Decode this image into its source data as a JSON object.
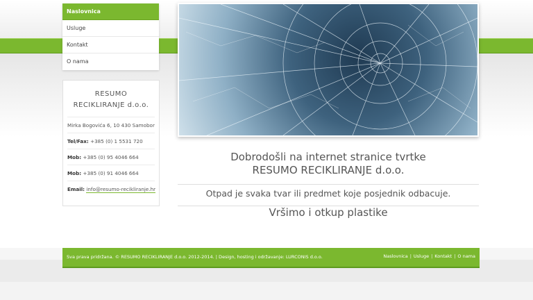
{
  "nav": {
    "items": [
      {
        "label": "Naslovnica",
        "active": true
      },
      {
        "label": "Usluge",
        "active": false
      },
      {
        "label": "Kontakt",
        "active": false
      },
      {
        "label": "O nama",
        "active": false
      }
    ]
  },
  "info": {
    "company_line1": "RESUMO",
    "company_line2": "RECIKLIRANJE d.o.o.",
    "address": "Mirka Bogovića 6, 10 430 Samobor",
    "telfax_label": "Tel/Fax:",
    "telfax": "+385 (0) 1 5531 720",
    "mob_label": "Mob:",
    "mob1": "+385 (0) 95 4046 664",
    "mob2": "+385 (0) 91 4046 664",
    "email_label": "Email:",
    "email": "info@resumo-recikliranje.hr"
  },
  "hero": {
    "icon": "broken-glass-image"
  },
  "main": {
    "welcome_line1": "Dobrodošli na internet stranice tvrtke",
    "welcome_line2": "RESUMO RECIKLIRANJE d.o.o.",
    "line1": "Otpad je svaka tvar ili predmet koje posjednik odbacuje.",
    "line2": "Vršimo i otkup plastike"
  },
  "footer": {
    "copyright": "Sva prava pridržana. © RESUMO RECIKLIRANJE d.o.o. 2012-2014. | Design, hosting i održavanje: LURCONIS d.o.o.",
    "links": [
      "Naslovnica",
      "Usluge",
      "Kontakt",
      "O nama"
    ]
  },
  "colors": {
    "accent": "#7bb82f",
    "accent_dark": "#5e9a1e"
  }
}
